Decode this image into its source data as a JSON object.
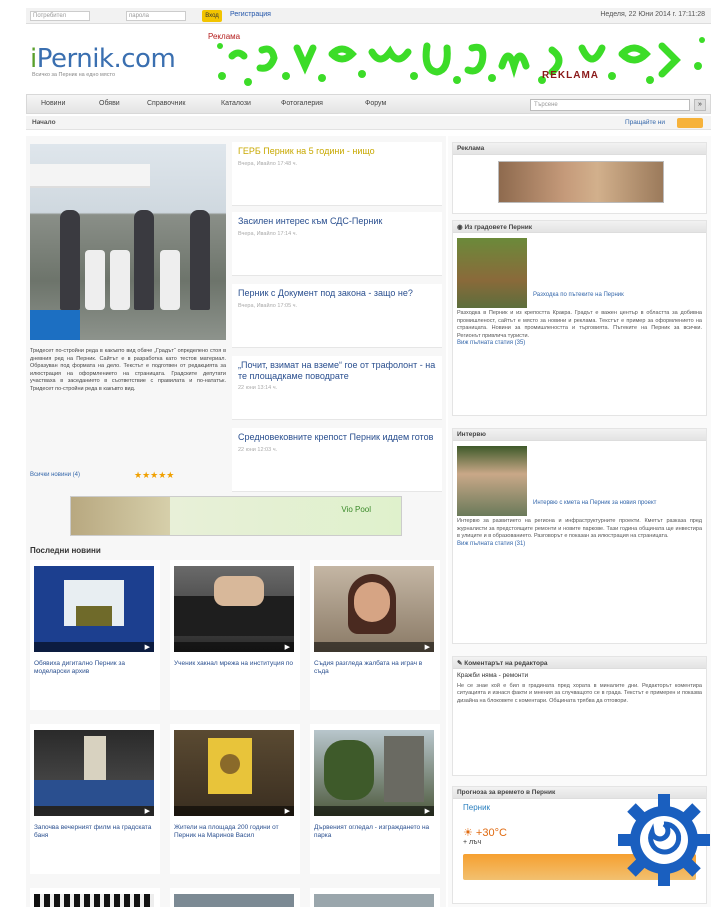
{
  "topbar": {
    "user_placeholder": "Потребител",
    "pass_placeholder": "парола",
    "login_label": "Вход",
    "register_label": "Регистрация",
    "date_text": "Неделя, 22 Юни 2014 г. 17:11:28"
  },
  "header": {
    "logo_prefix": "i",
    "logo_text": "Pernik.com",
    "tagline": "Всичко за Перник на едно място",
    "banner_ad_label": "Реклама",
    "banner_reklama": "REKLAMA"
  },
  "nav": {
    "items": [
      "Новини",
      "Обяви",
      "Справочник",
      "Каталози",
      "Фотогалерия",
      "Форум"
    ],
    "search_placeholder": "Търсене",
    "search_btn": "»"
  },
  "subbar": {
    "left": "Начало",
    "right": "Пращайте ни"
  },
  "feature": {
    "text": "Тридесет по-стройни реда в какъвто вид обаче „Градът“ определено стоя в дневния ред на Перник. Сайтът е в разработка като тестов материал. Образуван под формата на дело. Текстът е подготвен от редакцията за илюстрация на оформлението на страницата. Градските депутати участваха в заседанието в съответствие с правилата и по-нататък. Тридесет по-стройни реда в какъвто вид.",
    "meta": "Всички новини (4)",
    "stars": "★★★★★"
  },
  "news": [
    {
      "title": "ГЕРБ Перник на 5 години - нищо",
      "meta": "Вчера, Ивайло 17:48 ч."
    },
    {
      "title": "Засилен интерес към СДС-Перник",
      "meta": "Вчера, Ивайло 17:14 ч."
    },
    {
      "title": "Перник с Документ под закона - защо не?",
      "meta": "Вчера, Ивайло 17:05 ч."
    },
    {
      "title": "„Почит, взимат на вземе“ гое от трафолонт - на те площадкаме поводрате",
      "meta": "22 юни 13:14 ч."
    },
    {
      "title": "Средновековните крепост Перник иддем готов",
      "meta": "22 юни 12:03 ч."
    }
  ],
  "inner_banner": {
    "text": "Vio Pool"
  },
  "latest": {
    "title": "Последни новини",
    "cards": [
      {
        "caption": "Обявиха дигитално Перник за моделарски архив"
      },
      {
        "caption": "Ученик хакнал мрежа на институция по"
      },
      {
        "caption": "Съдия разгледа жалбата на играч в съда"
      },
      {
        "caption": "Започва вечерният филм на градската баня"
      },
      {
        "caption": "Жители на площада 200 години от Перник на Маринов Васил"
      },
      {
        "caption": "Дървеният огледал - изграждането на парка"
      }
    ]
  },
  "sidebar": {
    "ad_title": "Реклама",
    "gallery_title": "Из градовете Перник",
    "gallery_link": "Разходка по пътеките на Перник",
    "gallery_body": "Разходка в Перник и из крепостта Кракра. Градът е важен център в областта за добивна промишленост, сайтът е място за новини и реклама. Текстът е пример за оформлението на страницата. Новини за промишлеността и търговията. Пътеките на Перник за всички. Регионът привлича туристи.",
    "gallery_more": "Виж пълната статия (35)",
    "interview_title": "Интервю",
    "interview_link": "Интервю с кмета на Перник за новия проект",
    "interview_body": "Интервю за развитието на региона и инфраструктурните проекти. Кметът разказа пред журналисти за предстоящите ремонти и новите паркове. Тази година общината ще инвестира в улиците и в образованието. Разговорът е показан за илюстрация на страницата.",
    "interview_more": "Виж пълната статия (31)",
    "editor_title": "Коментарът на редактора",
    "editor_sub": "Кражби няма - ремонти",
    "editor_body": "Не се знае кой е бил в градината пред хората в миналите дни. Редакторът коментира ситуацията и изнася факти и мнения за случващото се в града. Текстът е примерен и показва дизайна на блоковете с коментари. Общината трябва да отговори.",
    "weather_title": "Прогноза за времето в Перник",
    "weather_city": "Перник",
    "weather_temp": "+30°С",
    "weather_feel": "+ лъч"
  },
  "colors": {
    "accent_blue": "#2a4f8f",
    "banner_green": "#3cdc28",
    "gear_blue": "#1a5fbf"
  }
}
